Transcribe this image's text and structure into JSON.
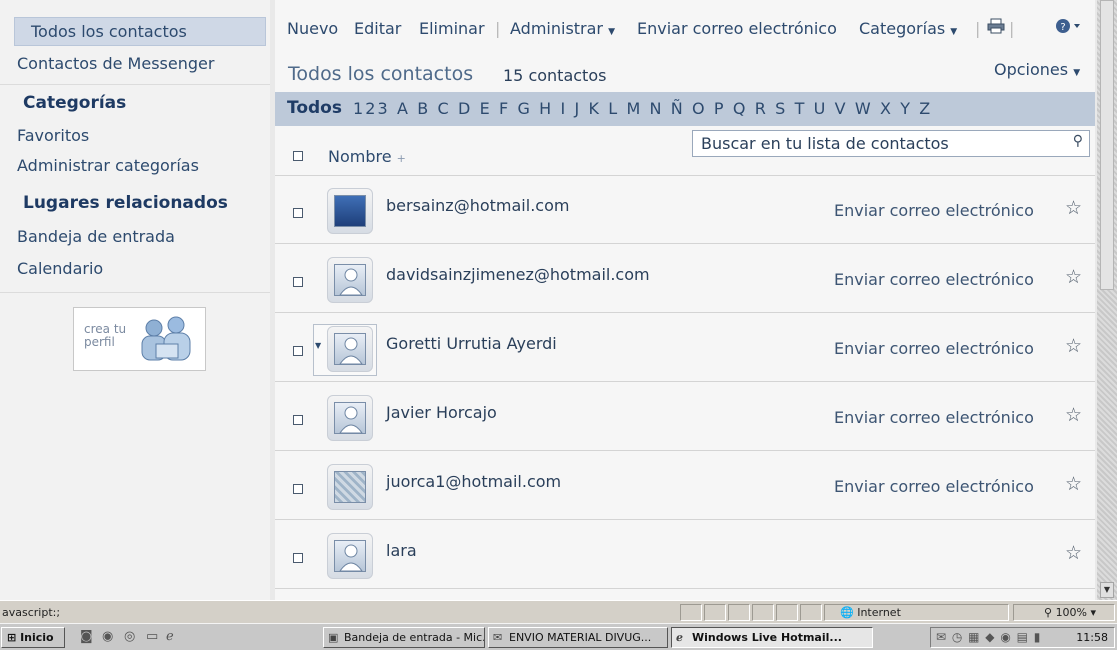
{
  "sidebar": {
    "all_contacts": "Todos los contactos",
    "messenger_contacts": "Contactos de Messenger",
    "categories_heading": "Categorías",
    "favorites": "Favoritos",
    "manage_categories": "Administrar categorías",
    "related_heading": "Lugares relacionados",
    "inbox": "Bandeja de entrada",
    "calendar": "Calendario",
    "profile_card": "crea tu perfil"
  },
  "toolbar": {
    "new": "Nuevo",
    "edit": "Editar",
    "delete": "Eliminar",
    "manage": "Administrar",
    "send_email": "Enviar correo electrónico",
    "categories": "Categorías",
    "separator": "|",
    "print_icon": "printer-icon",
    "help_icon": "help-icon"
  },
  "header": {
    "title": "Todos los contactos",
    "count": "15 contactos",
    "options": "Opciones"
  },
  "alphabet": {
    "all": "Todos",
    "letters": "123 A B C D E F G H I J K L M N Ñ O P Q R S T U V W X Y Z"
  },
  "search": {
    "placeholder": "Buscar en tu lista de contactos",
    "icon": "search-icon"
  },
  "list": {
    "name_header": "Nombre",
    "sort_glyph": "+",
    "send_label": "Enviar correo electrónico",
    "contacts": [
      {
        "name": "bersainz@hotmail.com",
        "send": "Enviar correo electrónico",
        "avatar": "dark-photo"
      },
      {
        "name": "davidsainzjimenez@hotmail.com",
        "send": "Enviar correo electrónico",
        "avatar": "default"
      },
      {
        "name": "Goretti Urrutia Ayerdi",
        "send": "Enviar correo electrónico",
        "avatar": "default"
      },
      {
        "name": "Javier Horcajo",
        "send": "Enviar correo electrónico",
        "avatar": "default"
      },
      {
        "name": "juorca1@hotmail.com",
        "send": "Enviar correo electrónico",
        "avatar": "photo"
      },
      {
        "name": "lara",
        "send": "",
        "avatar": "default"
      }
    ]
  },
  "statusbar": {
    "left_text": "avascript:;",
    "zone": "Internet",
    "zoom": "100%"
  },
  "taskbar": {
    "start": "Inicio",
    "tasks": [
      "Bandeja de entrada - Mic...",
      "ENVIO MATERIAL DIVUG...",
      "Windows Live Hotmail..."
    ],
    "clock": "11:58"
  },
  "colors": {
    "accent": "#2d4a6e",
    "alpha_bar": "#bdc9d9",
    "selected_nav": "#cfd8e6"
  }
}
